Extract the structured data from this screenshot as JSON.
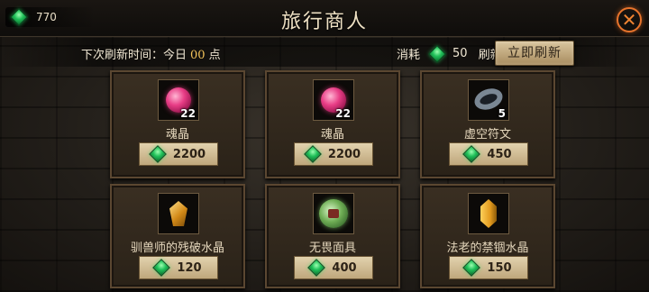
{
  "header": {
    "currency_amount": "770",
    "title": "旅行商人",
    "close_icon": "close-icon"
  },
  "refresh": {
    "label_prefix": "下次刷新时间：今日",
    "time": "00",
    "label_suffix": "点",
    "cost_label": "消耗",
    "cost_amount": "50",
    "cost_action": "刷新",
    "button_label": "立即刷新"
  },
  "items": [
    {
      "name": "魂晶",
      "quantity": "22",
      "price": "2200",
      "icon": "soul-crystal-icon"
    },
    {
      "name": "魂晶",
      "quantity": "22",
      "price": "2200",
      "icon": "soul-crystal-icon"
    },
    {
      "name": "虚空符文",
      "quantity": "5",
      "price": "450",
      "icon": "void-rune-icon"
    },
    {
      "name": "驯兽师的残破水晶",
      "quantity": "",
      "price": "120",
      "icon": "broken-crystal-icon"
    },
    {
      "name": "无畏面具",
      "quantity": "",
      "price": "400",
      "icon": "fearless-mask-icon"
    },
    {
      "name": "法老的禁锢水晶",
      "quantity": "",
      "price": "150",
      "icon": "pharaoh-crystal-icon"
    }
  ],
  "colors": {
    "accent": "#f08432",
    "gem": "#21c15a",
    "highlight": "#f2c25a"
  }
}
